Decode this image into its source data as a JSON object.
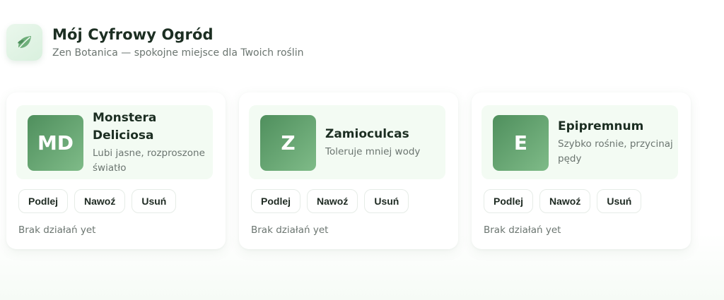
{
  "header": {
    "title": "Mój Cyfrowy Ogród",
    "subtitle": "Zen Botanica — spokojne miejsce dla Twoich roślin",
    "logo_icon": "leaf-icon"
  },
  "colors": {
    "accent": "#4f8f5d",
    "accent_light": "#7fbb88",
    "card_top_bg": "#f3fbf3"
  },
  "plants": [
    {
      "initials": "MD",
      "name": "Monstera Deliciosa",
      "description": "Lubi jasne, rozproszone światło",
      "actions": [
        "Podlej",
        "Nawoź",
        "Usuń"
      ],
      "status": "Brak działań yet"
    },
    {
      "initials": "Z",
      "name": "Zamioculcas",
      "description": "Toleruje mniej wody",
      "actions": [
        "Podlej",
        "Nawoź",
        "Usuń"
      ],
      "status": "Brak działań yet"
    },
    {
      "initials": "E",
      "name": "Epipremnum",
      "description": "Szybko rośnie, przycinaj pędy",
      "actions": [
        "Podlej",
        "Nawoź",
        "Usuń"
      ],
      "status": "Brak działań yet"
    }
  ]
}
